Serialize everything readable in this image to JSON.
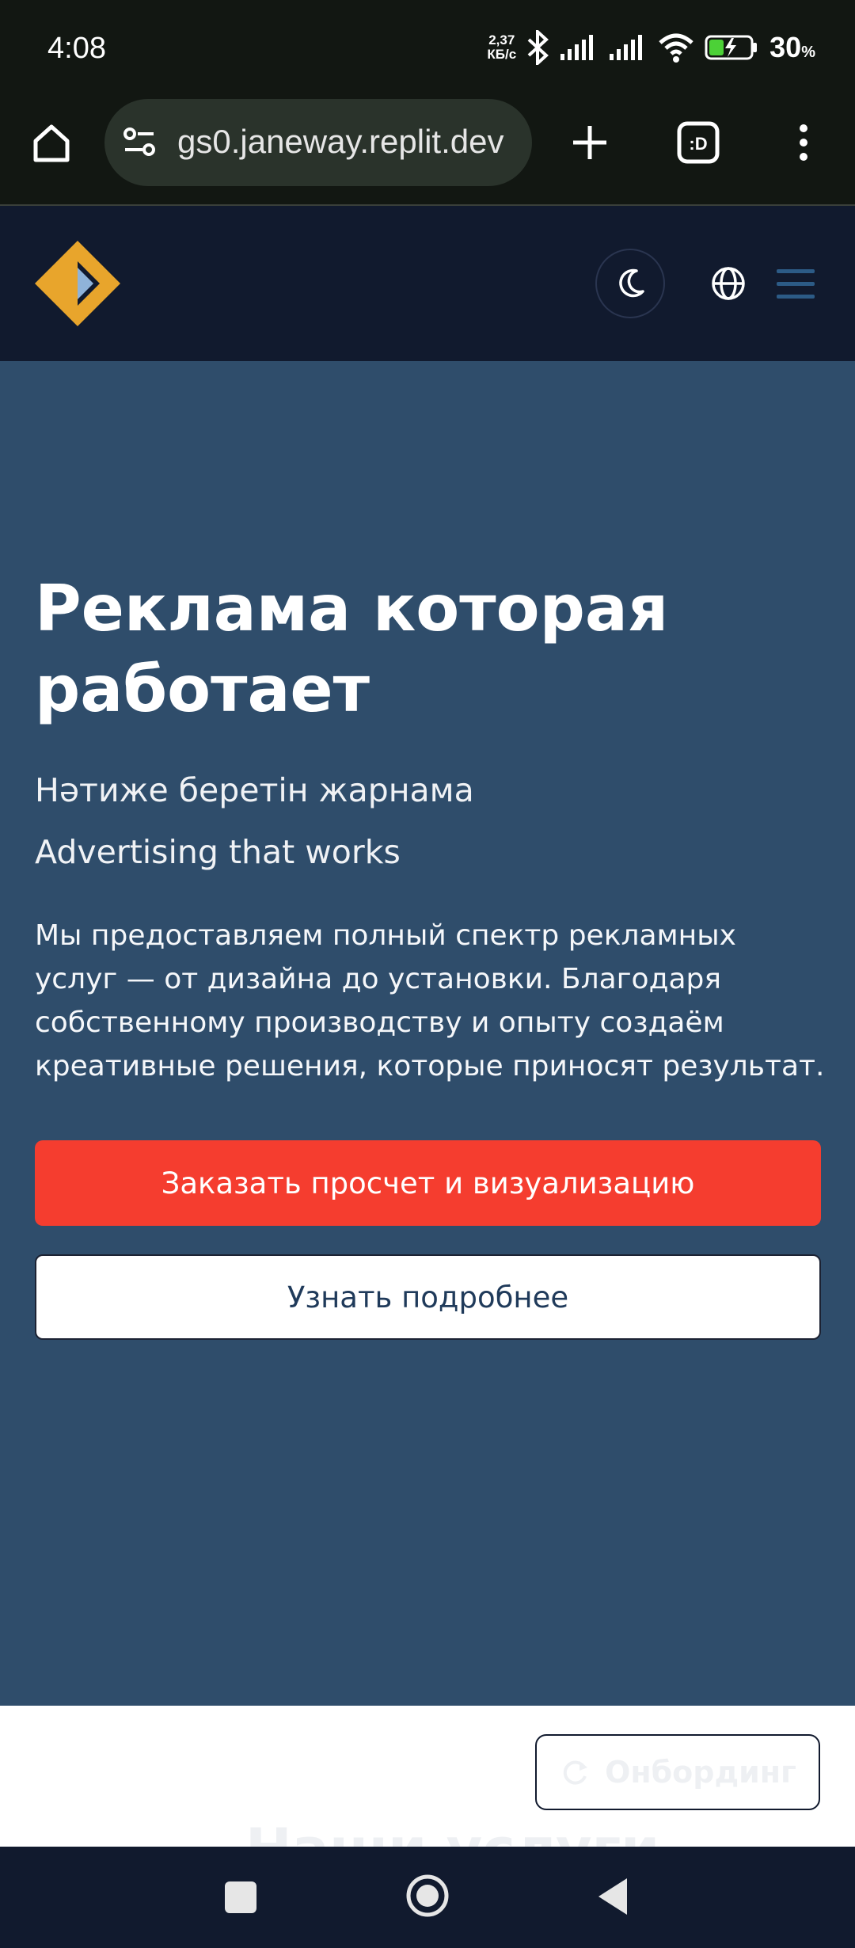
{
  "status_bar": {
    "time": "4:08",
    "net_speed": "2,37",
    "net_unit": "КБ/с",
    "battery_percent": "30",
    "battery_unit": "%"
  },
  "browser": {
    "url": "gs0.janeway.replit.dev"
  },
  "site_header": {
    "accent_color": "#e8a52c"
  },
  "hero": {
    "title": "Реклама которая работает",
    "subtitle_kk": "Нәтиже беретін жарнама",
    "subtitle_en": "Advertising that works",
    "description": "Мы предоставляем полный спектр рекламных услуг — от дизайна до установки. Благодаря собственному производству и опыту создаём креативные решения, которые приносят результат.",
    "primary_cta": "Заказать просчет и визуализацию",
    "secondary_cta": "Узнать подробнее"
  },
  "next_section": {
    "onboarding_label": "Онбординг",
    "title": "Наши услуги"
  },
  "colors": {
    "hero_bg": "#2f4d6b",
    "header_bg": "#111a2e",
    "primary": "#f53d2f"
  }
}
